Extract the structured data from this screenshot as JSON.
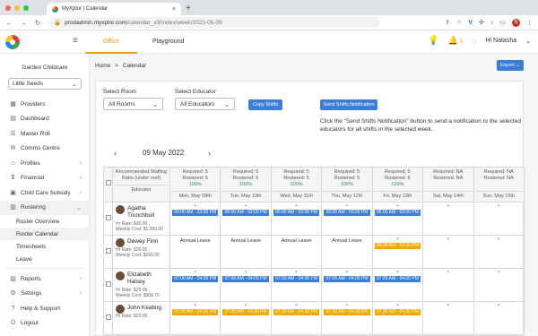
{
  "browser": {
    "tab_title": "MyXplor | Calendar",
    "url_host": "prodadmin.myxplor.com",
    "url_path": "/calendar_v3/index/week/2022-05-09",
    "avatar": "N"
  },
  "topbar": {
    "tabs": [
      {
        "label": "Office"
      },
      {
        "label": "Playground"
      }
    ],
    "notification_count": "5",
    "greeting": "Hi Natasha"
  },
  "sidebar": {
    "org": "Garden Childcare",
    "centre": "Little Seeds",
    "items": [
      {
        "label": "Providers",
        "icon": "building-icon"
      },
      {
        "label": "Dashboard",
        "icon": "dashboard-icon"
      },
      {
        "label": "Master Roll",
        "icon": "list-icon"
      },
      {
        "label": "Comms Centre",
        "icon": "comms-icon"
      },
      {
        "label": "Profiles",
        "icon": "profiles-icon"
      },
      {
        "label": "Financial",
        "icon": "dollar-icon"
      },
      {
        "label": "Child Care Subsidy",
        "icon": "ccs-icon"
      },
      {
        "label": "Rostering",
        "icon": "rostering-icon"
      }
    ],
    "subitems": [
      "Roster Overview",
      "Roster Calendar",
      "Timesheets",
      "Leave"
    ],
    "bottom": [
      {
        "label": "Reports",
        "icon": "reports-icon"
      },
      {
        "label": "Settings",
        "icon": "gear-icon"
      },
      {
        "label": "Help & Support",
        "icon": "help-icon"
      },
      {
        "label": "Logout",
        "icon": "logout-icon"
      }
    ]
  },
  "breadcrumb": {
    "home": "Home",
    "sep": ">",
    "current": "Calendar"
  },
  "export_label": "Export",
  "filters": {
    "room_label": "Select Room",
    "room_value": "All Rooms",
    "educator_label": "Select Educator",
    "educator_value": "All Educators",
    "copy_label": "Copy Shifts",
    "send_label": "Send Shifts Notification",
    "note": "Click the \"Send Shifts Notification\" button to send a notification to the selected educators for all shifts in the selected week."
  },
  "week_label": "09 May 2022",
  "table": {
    "header_first": "Recommended Staffing Ratio (under roof)",
    "header_educator": "Educator",
    "days": [
      {
        "req": "Required: 5",
        "ros": "Rostered: 5",
        "pct": "100%",
        "name": "Mon, May 09th"
      },
      {
        "req": "Required: 5",
        "ros": "Rostered: 5",
        "pct": "100%",
        "name": "Tue, May 10th"
      },
      {
        "req": "Required: 5",
        "ros": "Rostered: 5",
        "pct": "100%",
        "name": "Wed, May 11th"
      },
      {
        "req": "Required: 5",
        "ros": "Rostered: 5",
        "pct": "100%",
        "name": "Thu, May 12th"
      },
      {
        "req": "Required: 5",
        "ros": "Rostered: 6",
        "pct": "120%",
        "name": "Fri, May 13th"
      },
      {
        "req": "Required: NA",
        "ros": "Rostered: NA",
        "pct": "",
        "name": "Sat, May 14th"
      },
      {
        "req": "Required: NA",
        "ros": "Rostered: NA",
        "pct": "",
        "name": "Sun, May 15th"
      }
    ],
    "rows": [
      {
        "name": "Agatha Trunchbull",
        "rate": "Hr Rate: $30.00 ,",
        "weekly": "Weekly Cost: $1,350.00",
        "cells": [
          {
            "t": "06:00 AM - 03:00 PM",
            "c": "blue"
          },
          {
            "t": "06:00 AM - 03:00 PM",
            "c": "blue"
          },
          {
            "t": "06:00 AM - 03:00 PM",
            "c": "blue"
          },
          {
            "t": "06:00 AM - 03:00 PM",
            "c": "blue"
          },
          {
            "t": "06:00 AM - 03:00 PM",
            "c": "blue"
          },
          {
            "t": "",
            "c": ""
          },
          {
            "t": "",
            "c": ""
          }
        ]
      },
      {
        "name": "Dewey Finn",
        "rate": "Hr Rate: $20.00 ,",
        "weekly": "Weekly Cost: $155.00",
        "cells": [
          {
            "t": "Annual Leave",
            "c": "leave"
          },
          {
            "t": "Annual Leave",
            "c": "leave"
          },
          {
            "t": "Annual Leave",
            "c": "leave"
          },
          {
            "t": "Annual Leave",
            "c": "leave"
          },
          {
            "t": "08:30 AM - 03:30 PM",
            "c": "yel"
          },
          {
            "t": "",
            "c": ""
          },
          {
            "t": "",
            "c": ""
          }
        ]
      },
      {
        "name": "Elizabeth Halsey",
        "rate": "Hr Rate: $25.00 ,",
        "weekly": "Weekly Cost: $968.75",
        "cells": [
          {
            "t": "07:00 AM - 04:00 PM",
            "c": "blue"
          },
          {
            "t": "07:00 AM - 04:00 PM",
            "c": "blue"
          },
          {
            "t": "07:00 AM - 04:00 PM",
            "c": "blue"
          },
          {
            "t": "07:00 AM - 04:00 PM",
            "c": "blue"
          },
          {
            "t": "07:00 AM - 04:00 PM",
            "c": "blue"
          },
          {
            "t": "",
            "c": ""
          },
          {
            "t": "",
            "c": ""
          }
        ]
      },
      {
        "name": "John Keating",
        "rate": "Hr Rate: $20.00 ,",
        "weekly": "",
        "cells": [
          {
            "t": "07:30 AM - 04:30 PM",
            "c": "yel"
          },
          {
            "t": "07:30 AM - 04:30 PM",
            "c": "yel"
          },
          {
            "t": "07:30 AM - 04:30 PM",
            "c": "yel"
          },
          {
            "t": "07:30 AM - 04:30 PM",
            "c": "yel"
          },
          {
            "t": "07:30 AM - 04:30 PM",
            "c": "yel"
          },
          {
            "t": "",
            "c": ""
          },
          {
            "t": "",
            "c": ""
          }
        ]
      }
    ]
  },
  "colors": {
    "accent": "#f7941d",
    "primary": "#3b7dd8",
    "shift_yellow": "#f7a600",
    "ok_green": "#2e8b57"
  }
}
